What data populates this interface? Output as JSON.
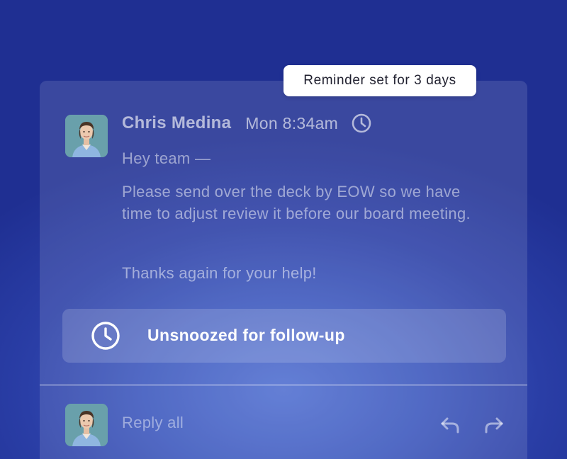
{
  "tooltip": {
    "text": "Reminder set for 3 days"
  },
  "message": {
    "sender": "Chris Medina",
    "timestamp": "Mon 8:34am",
    "greeting": "Hey team —",
    "body": "Please send over the deck by EOW so we have time to adjust review it before our board meeting.",
    "closing": "Thanks again for your help!",
    "status_icon": "clock-icon"
  },
  "snooze": {
    "label": "Unsnoozed for follow-up",
    "icon": "clock-icon"
  },
  "reply": {
    "placeholder": "Reply all",
    "reply_icon": "reply-arrow-icon",
    "forward_icon": "forward-arrow-icon"
  },
  "colors": {
    "background_dark": "#1f2f92",
    "background_light": "#4f6ed0",
    "tooltip_bg": "#ffffff",
    "text_primary": "#ffffff"
  }
}
